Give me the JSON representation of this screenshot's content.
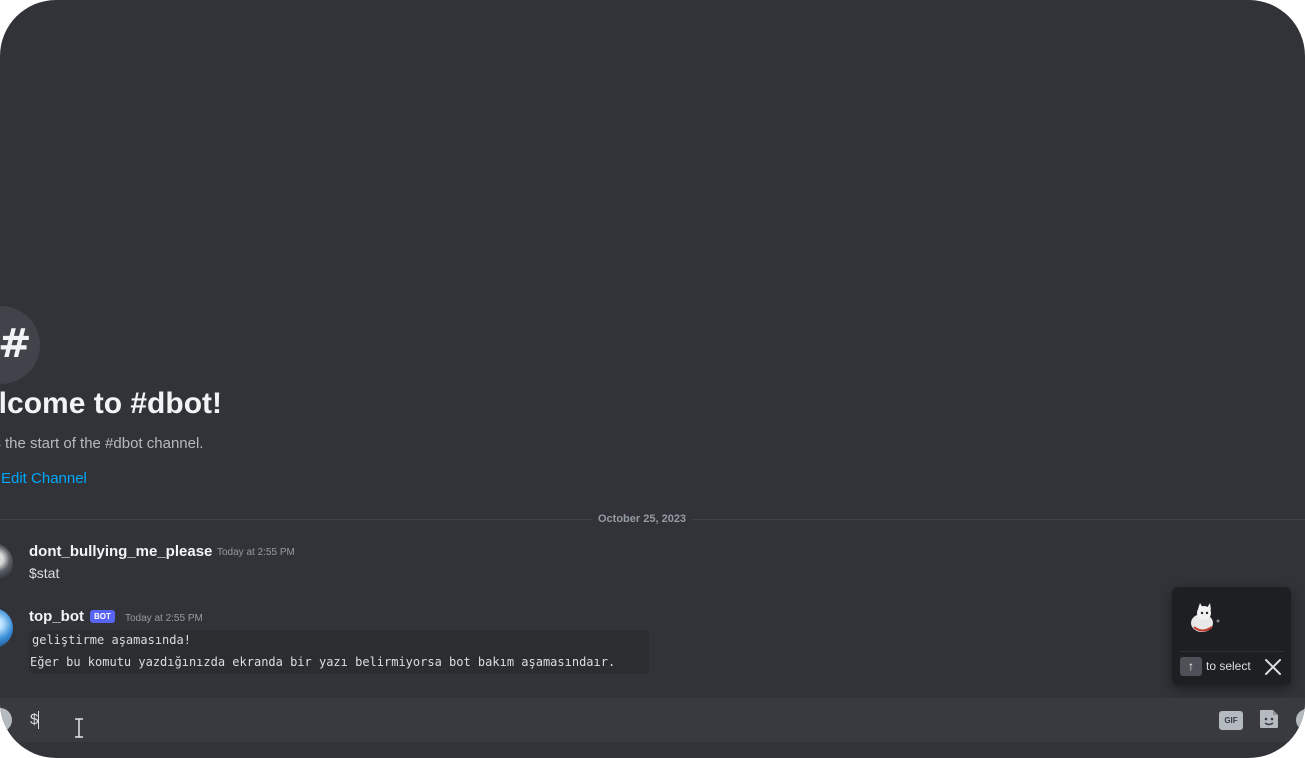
{
  "welcome": {
    "icon": "hash-icon",
    "icon_glyph": "#",
    "title": "elcome to #dbot!",
    "subtitle": "is the start of the #dbot channel.",
    "edit_link": "Edit Channel"
  },
  "divider": {
    "date": "October 25, 2023"
  },
  "messages": [
    {
      "username": "dont_bullying_me_please",
      "timestamp": "Today at 2:55 PM",
      "text": "$stat"
    },
    {
      "username": "top_bot",
      "badge": "BOT",
      "timestamp": "Today at 2:55 PM",
      "code_lines": [
        "geliştirme aşamasında!",
        "Eğer bu komutu yazdığınızda ekranda bir yazı belirmiyorsa bot bakım aşamasındaır."
      ]
    }
  ],
  "autocomplete": {
    "key_glyph": "↑",
    "hint": "to select",
    "close_icon": "close-icon"
  },
  "composer": {
    "value": "$",
    "gif_label": "GIF",
    "icons": [
      "plus-icon",
      "gif-icon",
      "sticker-icon",
      "emoji-icon"
    ]
  },
  "colors": {
    "background": "#313338",
    "link": "#00a8fc",
    "bot_badge": "#5865f2",
    "composer": "#383a40"
  }
}
